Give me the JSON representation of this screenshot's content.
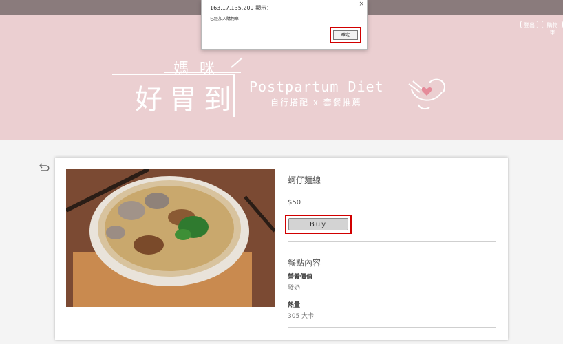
{
  "header": {
    "logout_label": "登出",
    "cart_label": "購物車"
  },
  "brand": {
    "title_small": "媽咪",
    "title_big": "好胃到",
    "english": "Postpartum Diet",
    "subtitle": "自行搭配 x 套餐推薦"
  },
  "product": {
    "name": "蚵仔麵線",
    "price": "$50",
    "buy_label": "Buy",
    "section_title": "餐點內容",
    "nutrition_label": "營養價值",
    "nutrition_value": "發奶",
    "calories_label": "熱量",
    "calories_value": "305 大卡"
  },
  "dialog": {
    "title": "163.17.135.209 顯示：",
    "message": "已經加入購物車",
    "ok_label": "確定",
    "close_glyph": "×"
  },
  "icons": {
    "back": "back-arrow-icon",
    "logo": "heart-bowl-logo-icon",
    "close": "close-icon"
  },
  "colors": {
    "hero": "#ebcfd1",
    "topbar": "#8a7b7c",
    "highlight": "#d10000"
  }
}
